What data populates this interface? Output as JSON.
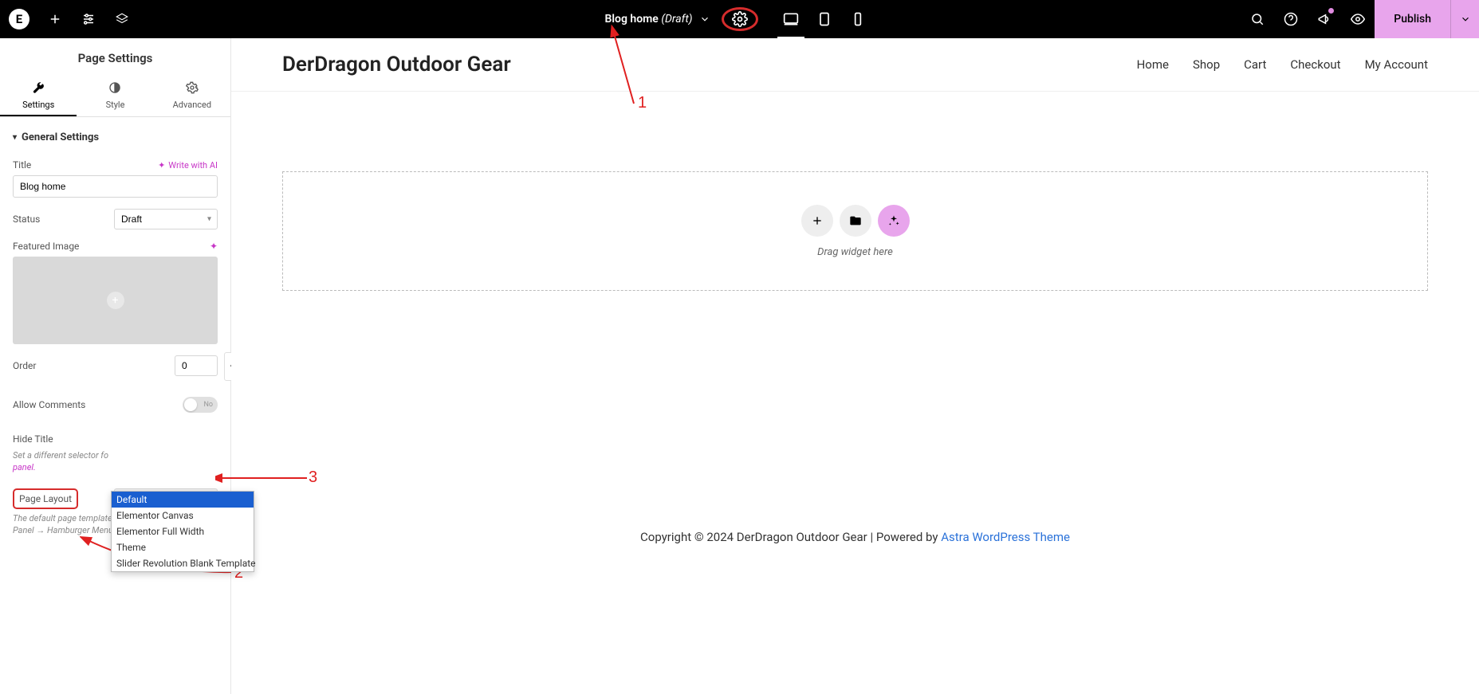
{
  "topbar": {
    "doc_title": "Blog home",
    "doc_status": "(Draft)"
  },
  "publish": {
    "label": "Publish"
  },
  "left_panel": {
    "title": "Page Settings",
    "tabs": {
      "settings": "Settings",
      "style": "Style",
      "advanced": "Advanced"
    },
    "section_header": "General Settings",
    "title_label": "Title",
    "write_ai": "Write with AI",
    "title_value": "Blog home",
    "status_label": "Status",
    "status_value": "Draft",
    "featured_label": "Featured Image",
    "order_label": "Order",
    "order_value": "0",
    "allow_comments_label": "Allow Comments",
    "toggle_no": "No",
    "hide_title_label": "Hide Title",
    "hide_title_help_prefix": "Set a different selector fo",
    "hide_title_help_link": "panel.",
    "page_layout_label": "Page Layout",
    "page_layout_value": "Default",
    "page_layout_help": "The default page template as defined in Elementor Panel → Hamburger Menu → Site Settings.",
    "dropdown": {
      "items": [
        "Default",
        "Elementor Canvas",
        "Elementor Full Width",
        "Theme",
        "Slider Revolution Blank Template"
      ]
    }
  },
  "canvas": {
    "site_title": "DerDragon Outdoor Gear",
    "nav": [
      "Home",
      "Shop",
      "Cart",
      "Checkout",
      "My Account"
    ],
    "drop_hint": "Drag widget here",
    "footer_prefix": "Copyright © 2024 DerDragon Outdoor Gear | Powered by ",
    "footer_link": "Astra WordPress Theme"
  },
  "annotations": {
    "n1": "1",
    "n2": "2",
    "n3": "3"
  }
}
